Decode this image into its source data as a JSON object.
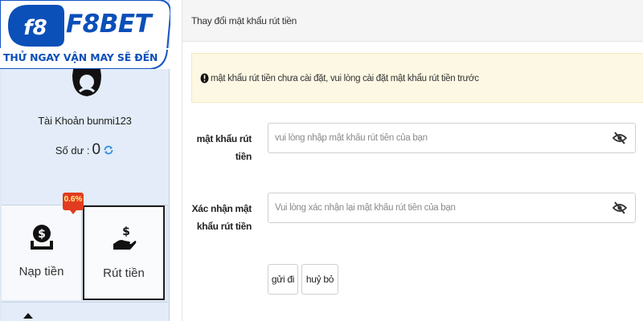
{
  "brand": {
    "logo_text": "F8BET",
    "slogan": "THỬ NGAY VẬN MAY SẼ ĐẾN",
    "accent_color": "#0b4fb8"
  },
  "sidebar": {
    "account_name": "Tài Khoản bunmi123",
    "balance_label": "Số dư :",
    "balance_value": "0",
    "badge": "0.6%",
    "actions": [
      {
        "label": "Nạp tiền",
        "icon": "deposit-money-icon"
      },
      {
        "label": "Rút tiền",
        "icon": "withdraw-money-icon"
      }
    ]
  },
  "main": {
    "title": "Thay đổi mật khẩu rút tiền",
    "alert": {
      "text": "mật khẩu rút tiền chưa cài đặt, vui lòng cài đặt mật khẩu rút tiền trước",
      "bg_color": "#fcf8e3"
    },
    "form": {
      "password_label": "mật khẩu rút tiền",
      "password_placeholder": "vui lòng nhập mật khẩu rút tiền của bạn",
      "password_value": "",
      "confirm_label_line1": "Xác nhận mật",
      "confirm_label_line2": "khẩu rút tiền",
      "confirm_placeholder": "Vui lòng xác nhận lại mật khẩu rút tiền của bạn",
      "confirm_value": "",
      "submit_label": "gửi đi",
      "cancel_label": "huỷ bỏ"
    }
  }
}
